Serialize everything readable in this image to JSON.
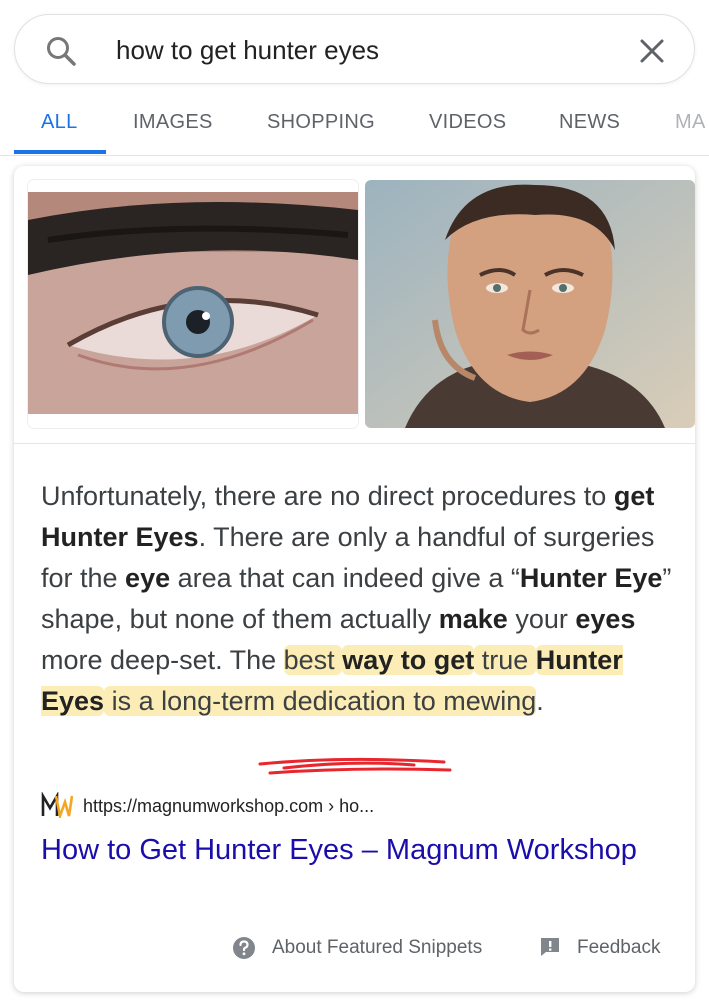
{
  "search": {
    "query": "how to get hunter eyes"
  },
  "tabs": [
    {
      "label": "ALL",
      "active": true
    },
    {
      "label": "IMAGES",
      "active": false
    },
    {
      "label": "SHOPPING",
      "active": false
    },
    {
      "label": "VIDEOS",
      "active": false
    },
    {
      "label": "NEWS",
      "active": false
    },
    {
      "label": "MA",
      "active": false
    }
  ],
  "snippet": {
    "segments": [
      {
        "text": "Unfortunately, there are no direct procedures to ",
        "bold": false,
        "highlight": false
      },
      {
        "text": "get Hunter Eyes",
        "bold": true,
        "highlight": false
      },
      {
        "text": ". There are only a handful of surgeries for the ",
        "bold": false,
        "highlight": false
      },
      {
        "text": "eye",
        "bold": true,
        "highlight": false
      },
      {
        "text": " area that can indeed give a “",
        "bold": false,
        "highlight": false
      },
      {
        "text": "Hunter Eye",
        "bold": true,
        "highlight": false
      },
      {
        "text": "” shape, but none of them actually ",
        "bold": false,
        "highlight": false
      },
      {
        "text": "make",
        "bold": true,
        "highlight": false
      },
      {
        "text": " your ",
        "bold": false,
        "highlight": false
      },
      {
        "text": "eyes",
        "bold": true,
        "highlight": false
      },
      {
        "text": " more deep-set. The ",
        "bold": false,
        "highlight": false
      },
      {
        "text": "best ",
        "bold": false,
        "highlight": true
      },
      {
        "text": "way to get",
        "bold": true,
        "highlight": true
      },
      {
        "text": " true ",
        "bold": false,
        "highlight": true
      },
      {
        "text": "Hunter Eyes",
        "bold": true,
        "highlight": true
      },
      {
        "text": " is a long-term dedication to mewing",
        "bold": false,
        "highlight": true
      },
      {
        "text": ".",
        "bold": false,
        "highlight": false
      }
    ]
  },
  "source": {
    "favicon_text": "MW",
    "url": "https://magnumworkshop.com › ho..."
  },
  "result": {
    "title": "How to Get Hunter Eyes – Magnum Workshop"
  },
  "footer": {
    "about": "About Featured Snippets",
    "feedback": "Feedback"
  },
  "colors": {
    "link": "#1a0dab",
    "tab_active": "#1a73e8",
    "highlight": "#f7de78",
    "annotation": "#e8262d"
  },
  "icons": {
    "search": "search-icon",
    "clear": "close-icon",
    "help": "help-circle-icon",
    "feedback": "feedback-icon"
  }
}
